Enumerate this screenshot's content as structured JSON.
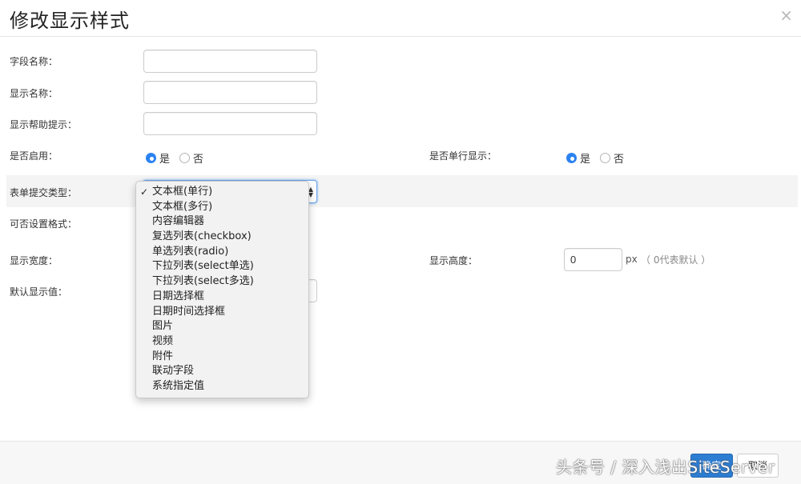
{
  "modal": {
    "title": "修改显示样式",
    "close_glyph": "×"
  },
  "form": {
    "field_name_label": "字段名称：",
    "field_name_value": "",
    "display_name_label": "显示名称：",
    "display_name_value": "",
    "help_label": "显示帮助提示：",
    "help_value": "",
    "enabled_label": "是否启用：",
    "enabled_yes": "是",
    "enabled_no": "否",
    "enabled_selected": "是",
    "single_line_label": "是否单行显示：",
    "single_line_yes": "是",
    "single_line_no": "否",
    "single_line_selected": "是",
    "submit_type_label": "表单提交类型：",
    "submit_type_selected": "文本框(单行)",
    "submit_type_options": [
      "文本框(单行)",
      "文本框(多行)",
      "内容编辑器",
      "复选列表(checkbox)",
      "单选列表(radio)",
      "下拉列表(select单选)",
      "下拉列表(select多选)",
      "日期选择框",
      "日期时间选择框",
      "图片",
      "视频",
      "附件",
      "联动字段",
      "系统指定值"
    ],
    "format_label": "可否设置格式：",
    "width_label": "显示宽度：",
    "height_label": "显示高度：",
    "height_value": "0",
    "height_unit": "px",
    "height_hint": "（ 0代表默认 ）",
    "default_label": "默认显示值："
  },
  "footer": {
    "confirm_label": "确定",
    "cancel_label": "取消"
  },
  "watermark": "头条号 / 深入浅出SiteServer",
  "colors": {
    "accent": "#2b82f0",
    "primary_button": "#2d7dd2"
  }
}
